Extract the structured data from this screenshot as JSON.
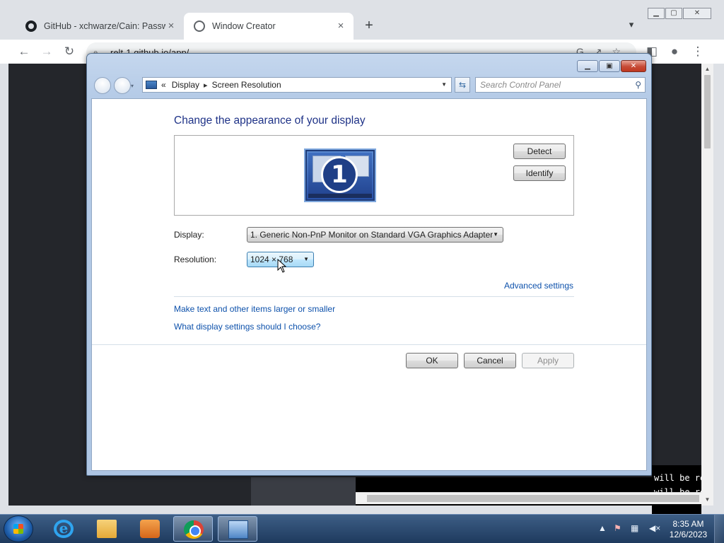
{
  "browser": {
    "tabs": [
      {
        "title": "GitHub - xchwarze/Cain: Password",
        "icon": "github-icon"
      },
      {
        "title": "Window Creator",
        "icon": "globe-icon"
      }
    ],
    "url": "relt-1.github.io/app/"
  },
  "viewport": {
    "terminal_lines": [
      "will be re",
      "will be re"
    ]
  },
  "window": {
    "breadcrumb": {
      "root": "Display",
      "current": "Screen Resolution"
    },
    "search_placeholder": "Search Control Panel",
    "heading": "Change the appearance of your display",
    "monitor_number": "1",
    "detect_label": "Detect",
    "identify_label": "Identify",
    "display_label": "Display:",
    "display_value": "1. Generic Non-PnP Monitor on Standard VGA Graphics Adapter",
    "resolution_label": "Resolution:",
    "resolution_value": "1024 × 768",
    "advanced_link": "Advanced settings",
    "text_size_link": "Make text and other items larger or smaller",
    "help_link": "What display settings should I choose?",
    "ok_label": "OK",
    "cancel_label": "Cancel",
    "apply_label": "Apply"
  },
  "taskbar": {
    "apps": [
      "internet-explorer",
      "windows-explorer",
      "media-player",
      "chrome",
      "control-panel"
    ],
    "time": "8:35 AM",
    "date": "12/6/2023"
  },
  "colors": {
    "heading": "#1e3287",
    "link": "#0d51ab",
    "desktop": "#2b76c4"
  }
}
